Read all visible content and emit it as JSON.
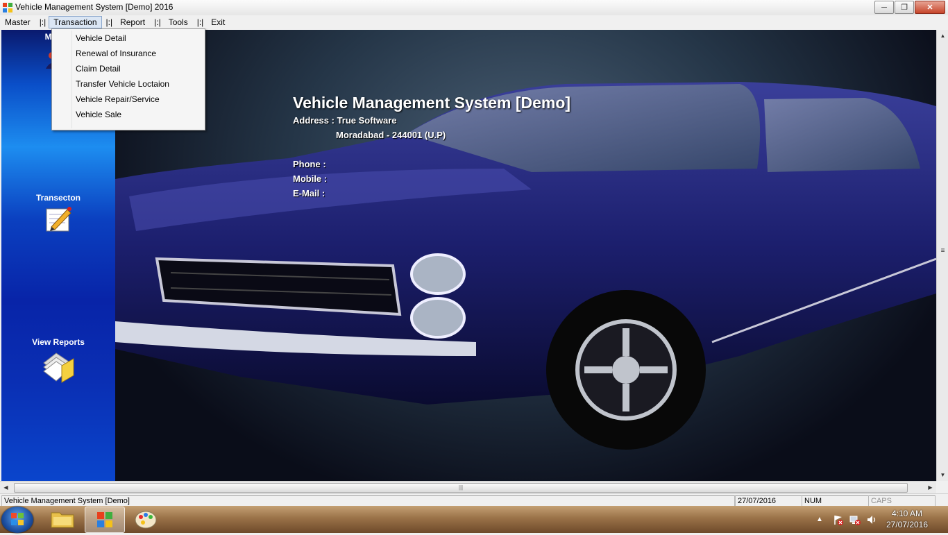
{
  "window": {
    "title": "Vehicle Management System [Demo]      2016",
    "buttons": [
      "minimize",
      "maximize",
      "close"
    ]
  },
  "menubar": {
    "master": "Master",
    "sep1": "|:|",
    "transaction": "Transaction",
    "sep2": "|:|",
    "report": "Report",
    "sep3": "|:|",
    "tools": "Tools",
    "sep4": "|:|",
    "exit": "Exit"
  },
  "transaction_menu": {
    "items": [
      "Vehicle Detail",
      "Renewal of Insurance",
      "Claim Detail",
      "Transfer Vehicle Loctaion",
      "Vehicle Repair/Service",
      "Vehicle Sale"
    ]
  },
  "sidebar": {
    "items": [
      {
        "label": "Master",
        "icon": "users-icon"
      },
      {
        "label": "Transecton",
        "icon": "pencil-notepad-icon"
      },
      {
        "label": "View Reports",
        "icon": "reports-folder-icon"
      }
    ]
  },
  "company": {
    "title": "Vehicle Management System [Demo]",
    "address_line1": "Address : True  Software",
    "address_line2": "Moradabad - 244001 (U.P)",
    "phone": "Phone     :",
    "mobile": "Mobile    :",
    "email": "E-Mail    :"
  },
  "statusbar": {
    "app": "Vehicle Management System [Demo]",
    "date": "27/07/2016",
    "num": "NUM",
    "caps": "CAPS"
  },
  "taskbar": {
    "pinned": [
      "start-orb-icon",
      "explorer-icon",
      "app-icon",
      "paint-icon"
    ],
    "clock_time": "4:10 AM",
    "clock_date": "27/07/2016"
  },
  "colors": {
    "sidebar_top": "#0a1a6e",
    "sidebar_mid": "#1d8df0",
    "car_body": "#1c1f6e",
    "menu_highlight": "#dbe6f4"
  }
}
